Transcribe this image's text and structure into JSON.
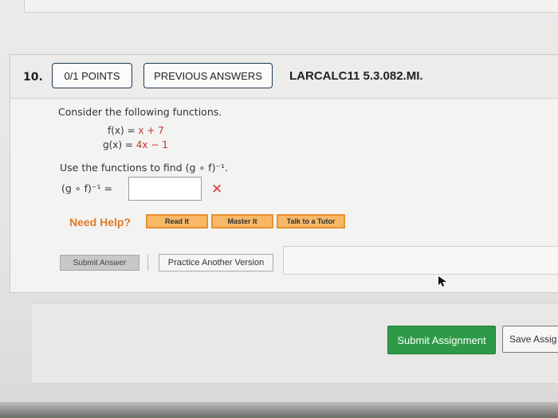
{
  "question": {
    "number": "10.",
    "points_button": "0/1 POINTS",
    "previous_answers_button": "PREVIOUS ANSWERS",
    "code": "LARCALC11 5.3.082.MI."
  },
  "body": {
    "prompt": "Consider the following functions.",
    "f_lhs": "f(x)  =",
    "f_rhs": "x + 7",
    "g_lhs": "g(x)  =",
    "g_rhs": "4x − 1",
    "find_text": "Use the functions to find (g ∘ f)⁻¹.",
    "answer_label": "(g ∘ f)⁻¹ =",
    "answer_value": "",
    "result_icon": "×"
  },
  "help": {
    "label": "Need Help?",
    "read_it": "Read It",
    "master_it": "Master It",
    "talk_to_tutor": "Talk to a Tutor"
  },
  "actions": {
    "submit_answer": "Submit Answer",
    "practice_another": "Practice Another Version"
  },
  "assignment": {
    "submit_assignment": "Submit Assignment",
    "save_assignment": "Save Assig"
  },
  "colors": {
    "accent_green": "#2e9a47",
    "error_red": "#d9534f",
    "help_orange": "#e07a2a"
  }
}
